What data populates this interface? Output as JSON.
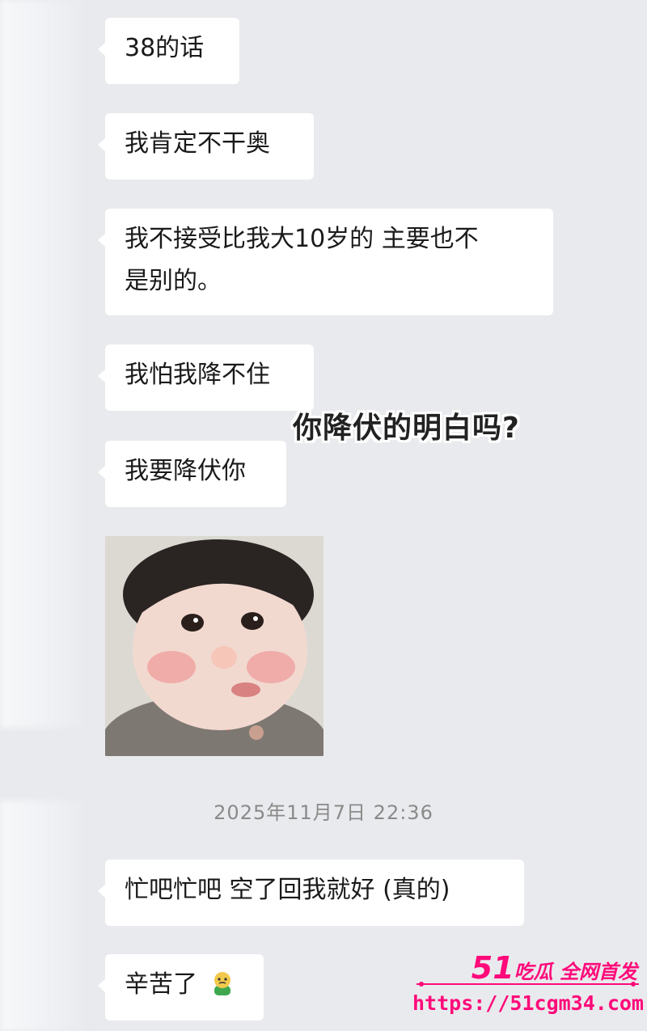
{
  "messages": [
    {
      "text": "38的话"
    },
    {
      "text": "我肯定不干奥"
    },
    {
      "line1": "我不接受比我大10岁的 主要也不",
      "line2": "是别的。"
    },
    {
      "text": "我怕我降不住"
    },
    {
      "text": "我要降伏你"
    }
  ],
  "overlay_caption": "你降伏的明白吗?",
  "timestamp": "2025年11月7日 22:36",
  "messages_after": [
    {
      "text": "忙吧忙吧 空了回我就好 (真的)"
    },
    {
      "text": "辛苦了"
    }
  ],
  "watermark": {
    "number": "51",
    "brand": "吃瓜 全网首发",
    "url": "https://51cgm34.com"
  },
  "colors": {
    "background": "#e9eaed",
    "bubble": "#ffffff",
    "watermark": "#ff0a7a"
  },
  "icons": {
    "sticker": "child-face-sticker",
    "emoji": "sick-face-emoji"
  }
}
